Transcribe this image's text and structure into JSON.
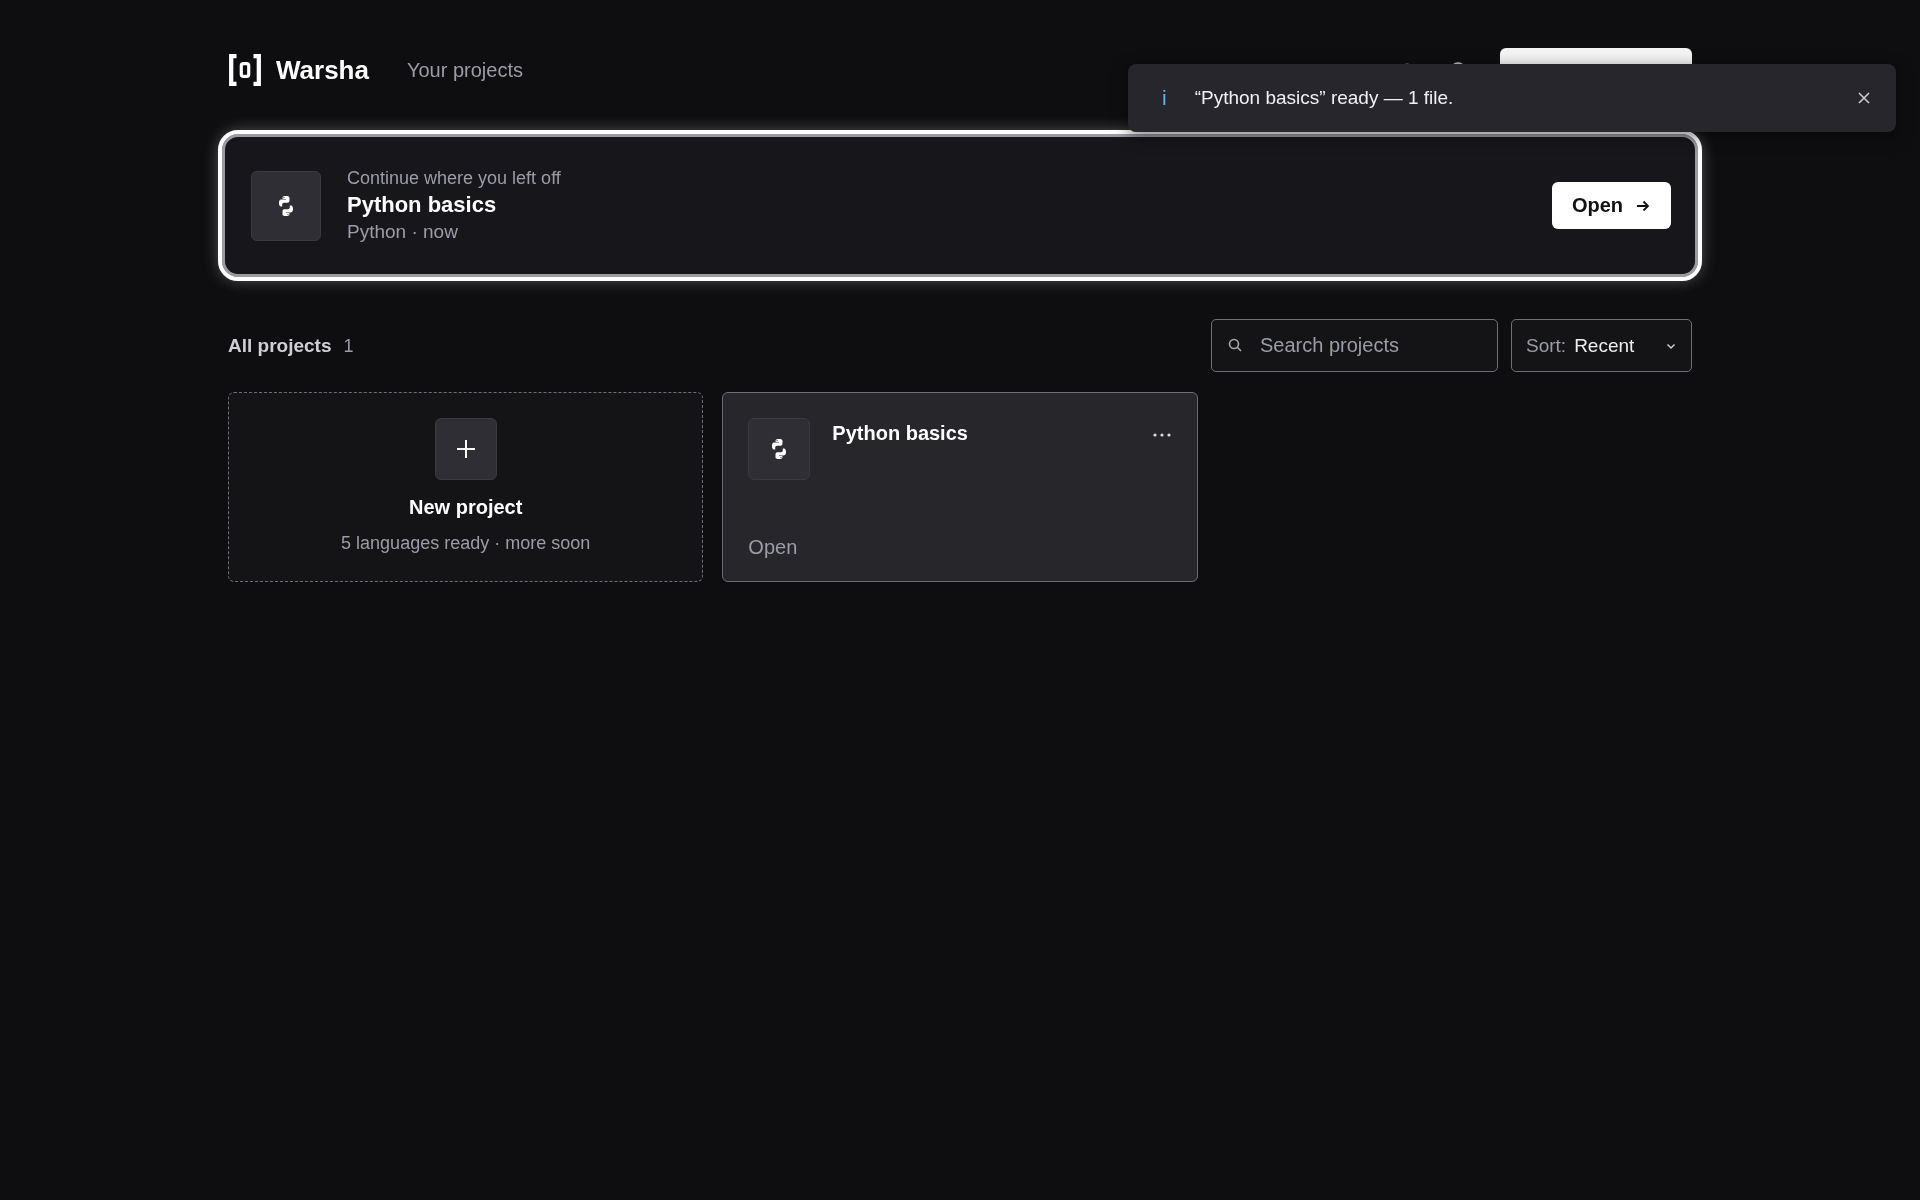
{
  "header": {
    "brand": "Warsha",
    "nav_link": "Your projects"
  },
  "toast": {
    "icon": "i",
    "message": "“Python basics” ready — 1 file."
  },
  "continue_card": {
    "focused": true,
    "eyebrow": "Continue where you left off",
    "title": "Python basics",
    "meta": "Python · now",
    "button": "Open"
  },
  "projects": {
    "heading": "All projects",
    "count": "1",
    "search": {
      "placeholder": "Search projects"
    },
    "sort": {
      "label": "Sort:",
      "value": "Recent"
    },
    "new_card": {
      "title": "New project",
      "subtitle": "5 languages ready · more soon"
    },
    "items": [
      {
        "title": "Python basics",
        "action": "Open"
      }
    ]
  }
}
